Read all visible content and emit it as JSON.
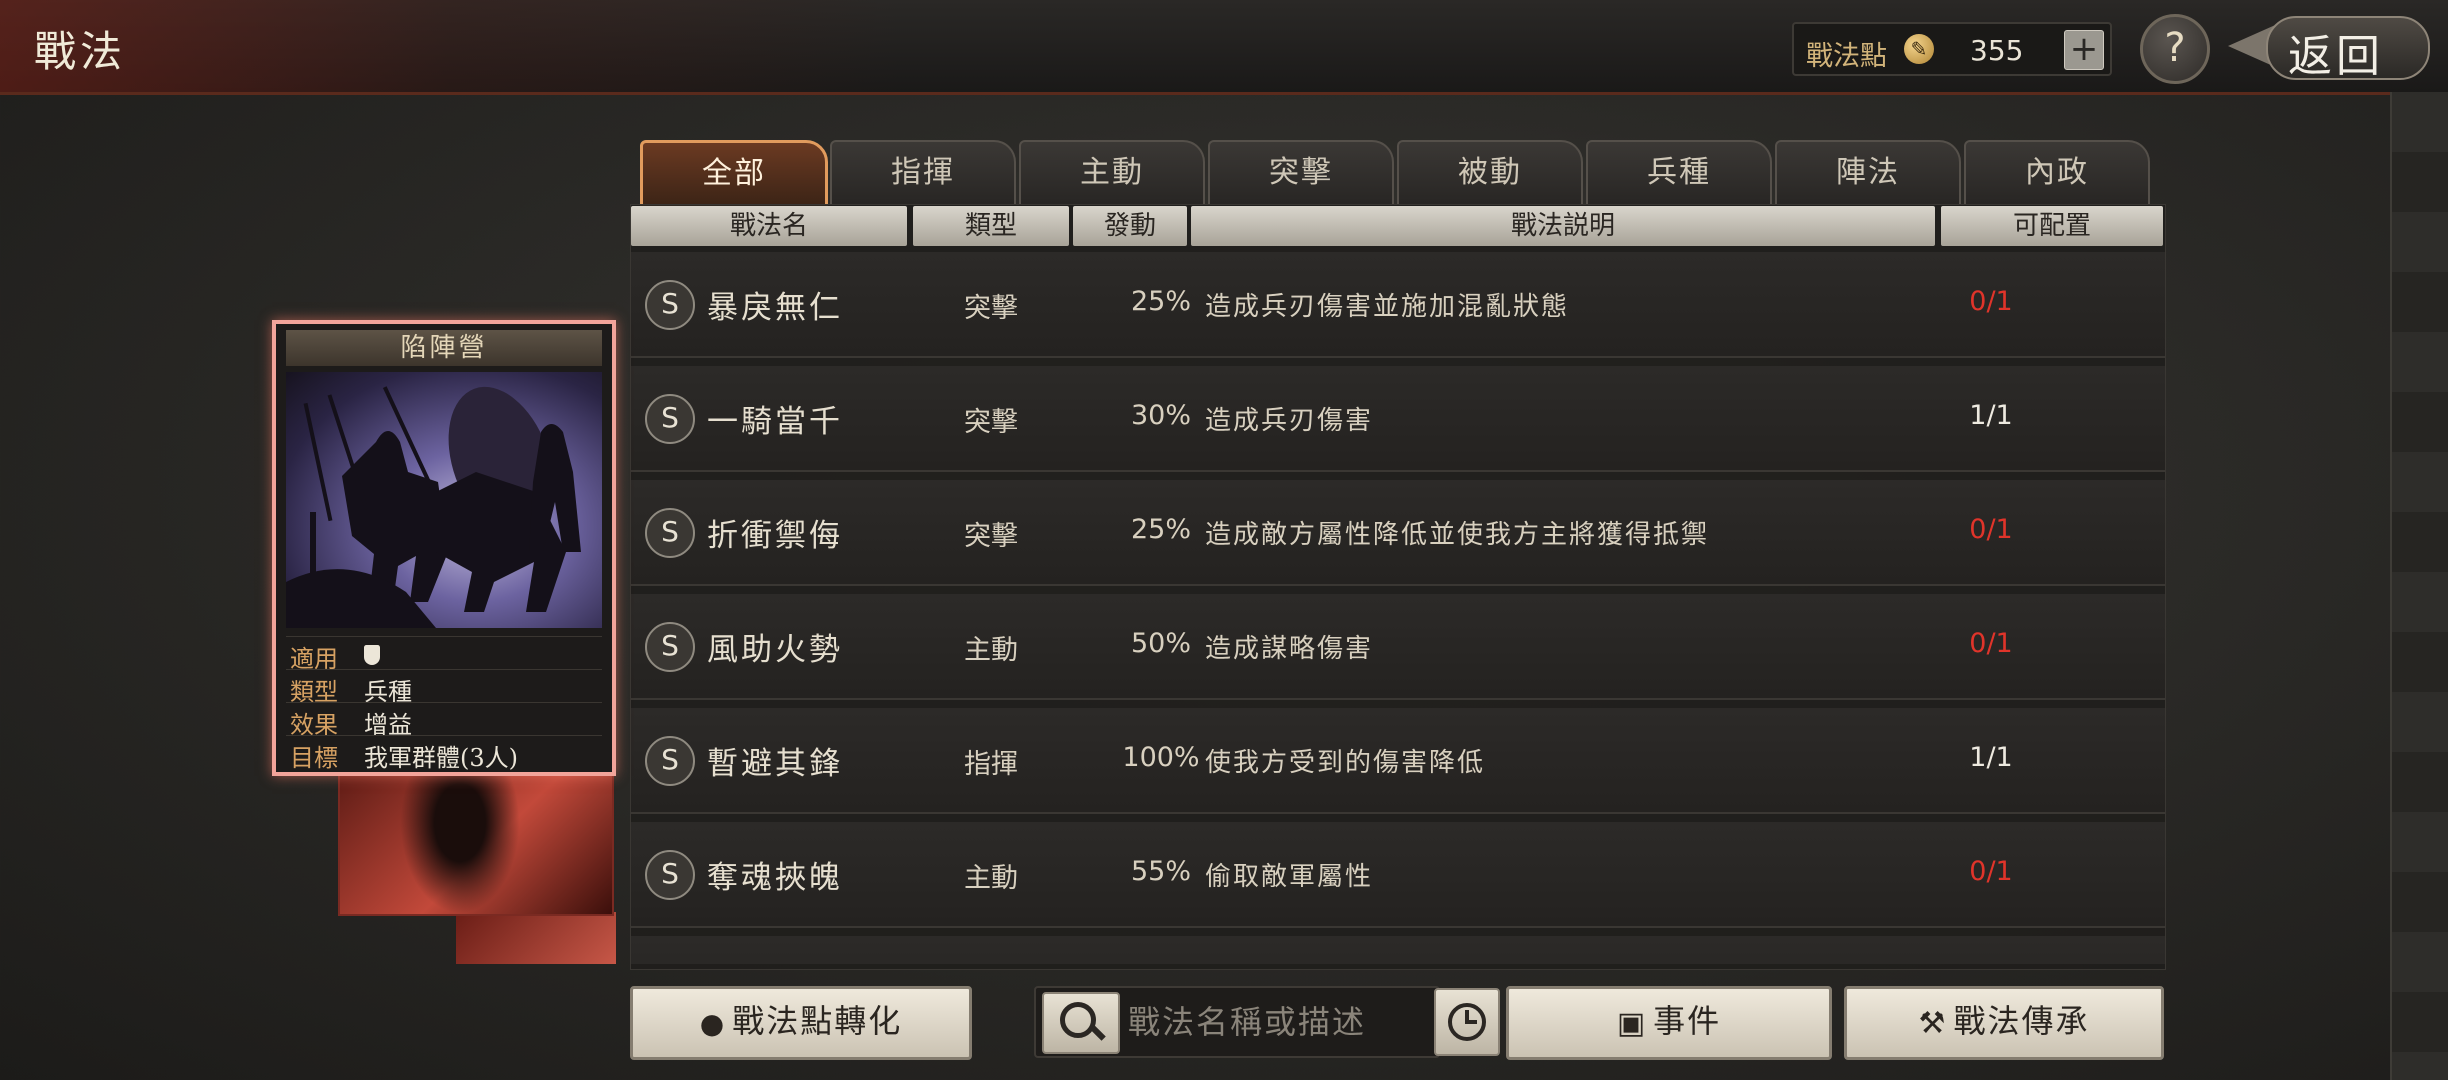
{
  "header": {
    "title": "戰法",
    "points_label": "戰法點",
    "points_value": "355",
    "plus_label": "+",
    "help_label": "?",
    "back_label": "返回"
  },
  "tabs": [
    {
      "label": "全部",
      "active": true
    },
    {
      "label": "指揮",
      "active": false
    },
    {
      "label": "主動",
      "active": false
    },
    {
      "label": "突擊",
      "active": false
    },
    {
      "label": "被動",
      "active": false
    },
    {
      "label": "兵種",
      "active": false
    },
    {
      "label": "陣法",
      "active": false
    },
    {
      "label": "內政",
      "active": false
    }
  ],
  "columns": {
    "name": "戰法名",
    "type": "類型",
    "rate": "發動",
    "desc": "戰法説明",
    "cfg": "可配置"
  },
  "rows": [
    {
      "grade": "S",
      "name": "暴戾無仁",
      "type": "突擊",
      "rate": "25%",
      "desc": "造成兵刃傷害並施加混亂狀態",
      "cfg": "0/1",
      "cfg_color": "#e0342a"
    },
    {
      "grade": "S",
      "name": "一騎當千",
      "type": "突擊",
      "rate": "30%",
      "desc": "造成兵刃傷害",
      "cfg": "1/1",
      "cfg_color": "#eeeae0"
    },
    {
      "grade": "S",
      "name": "折衝禦侮",
      "type": "突擊",
      "rate": "25%",
      "desc": "造成敵方屬性降低並使我方主將獲得抵禦",
      "cfg": "0/1",
      "cfg_color": "#e0342a"
    },
    {
      "grade": "S",
      "name": "風助火勢",
      "type": "主動",
      "rate": "50%",
      "desc": "造成謀略傷害",
      "cfg": "0/1",
      "cfg_color": "#e0342a"
    },
    {
      "grade": "S",
      "name": "暫避其鋒",
      "type": "指揮",
      "rate": "100%",
      "desc": "使我方受到的傷害降低",
      "cfg": "1/1",
      "cfg_color": "#eeeae0"
    },
    {
      "grade": "S",
      "name": "奪魂挾魄",
      "type": "主動",
      "rate": "55%",
      "desc": "偷取敵軍屬性",
      "cfg": "0/1",
      "cfg_color": "#e0342a"
    }
  ],
  "card": {
    "title": "陷陣營",
    "info": [
      {
        "key": "適用",
        "value": ""
      },
      {
        "key": "類型",
        "value": "兵種"
      },
      {
        "key": "效果",
        "value": "增益"
      },
      {
        "key": "目標",
        "value": "我軍群體(3人)"
      }
    ]
  },
  "bottom": {
    "convert_label": "戰法點轉化",
    "search_placeholder": "戰法名稱或描述",
    "event_label": "事件",
    "inherit_label": "戰法傳承"
  }
}
